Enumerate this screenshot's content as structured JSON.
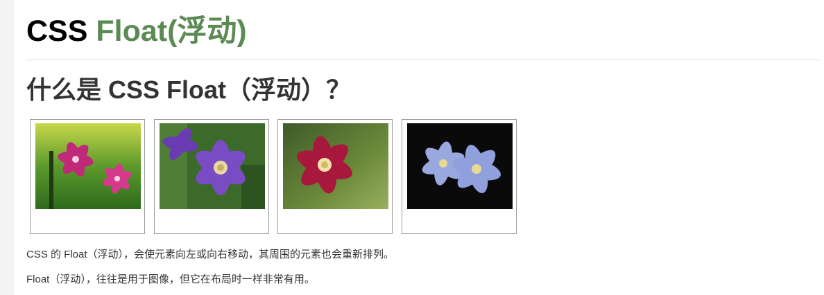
{
  "header": {
    "title_prefix": "CSS",
    "title_accent": "Float(浮动)"
  },
  "section": {
    "heading": "什么是 CSS Float（浮动）？"
  },
  "gallery": {
    "images": [
      {
        "name": "pink-clematis"
      },
      {
        "name": "purple-clematis"
      },
      {
        "name": "red-clematis"
      },
      {
        "name": "blue-clematis"
      }
    ]
  },
  "paragraphs": [
    "CSS 的 Float（浮动），会使元素向左或向右移动，其周围的元素也会重新排列。",
    "Float（浮动），往往是用于图像，但它在布局时一样非常有用。"
  ],
  "colors": {
    "accent": "#5b8a52",
    "text": "#333333",
    "border": "#999999"
  }
}
